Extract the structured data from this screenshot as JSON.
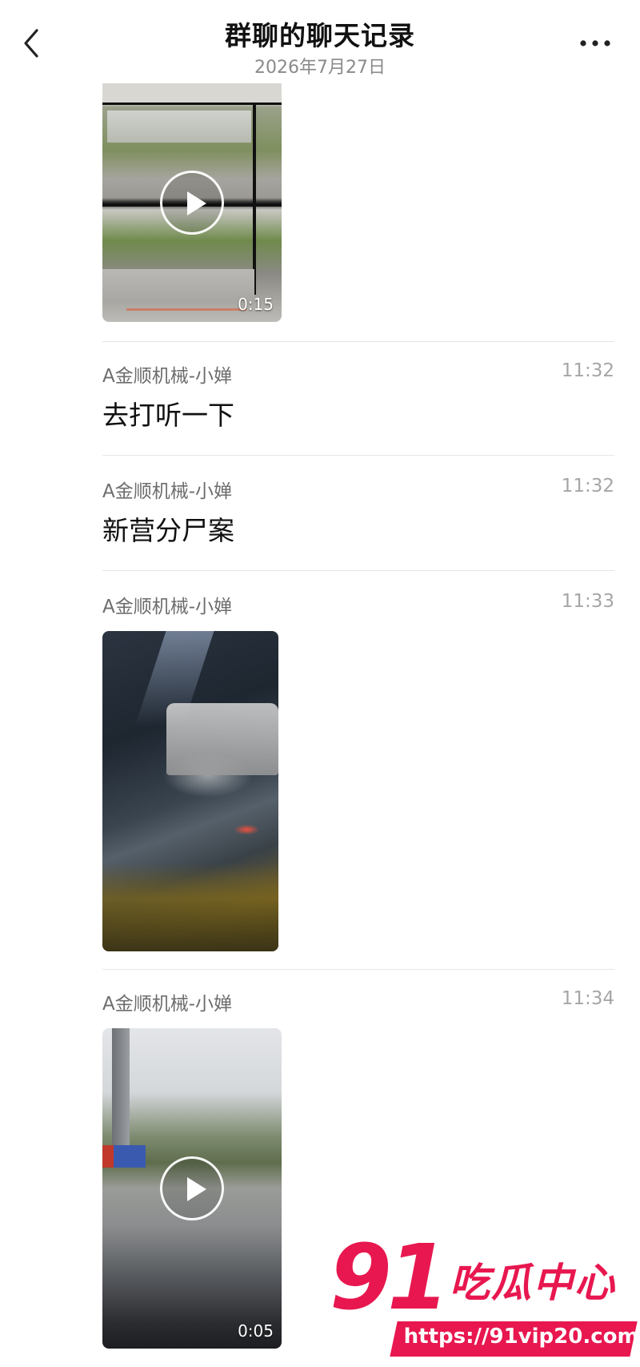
{
  "header": {
    "title": "群聊的聊天记录",
    "date": "2026年7月27日",
    "back_icon": "chevron-left-icon",
    "more_icon": "more-dots-icon"
  },
  "messages": [
    {
      "type": "video",
      "duration": "0:15"
    },
    {
      "type": "text",
      "sender": "A金顺机械-小婵",
      "time": "11:32",
      "text": "去打听一下"
    },
    {
      "type": "text",
      "sender": "A金顺机械-小婵",
      "time": "11:32",
      "text": "新营分尸案"
    },
    {
      "type": "image",
      "sender": "A金顺机械-小婵",
      "time": "11:33"
    },
    {
      "type": "video",
      "sender": "A金顺机械-小婵",
      "time": "11:34",
      "duration": "0:05"
    }
  ],
  "watermark": {
    "brand_number": "91",
    "brand_text": "吃瓜中心",
    "url": "https://91vip20.com",
    "color": "#e8174f"
  }
}
